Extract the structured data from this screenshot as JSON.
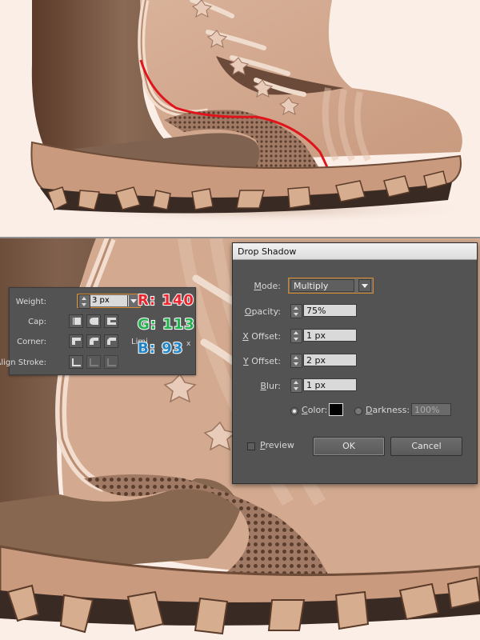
{
  "stroke_panel": {
    "weight_label": "Weight:",
    "weight_value": "3 px",
    "cap_label": "Cap:",
    "corner_label": "Corner:",
    "limit_label": "Limi",
    "limit_suffix": "x",
    "align_label": "Align Stroke:"
  },
  "rgb_callout": {
    "r": "R: 140",
    "g": "G: 113",
    "b": "B: 93",
    "colors": {
      "r": "#e8262f",
      "g": "#23b14d",
      "b": "#1f85c8"
    }
  },
  "drop_shadow": {
    "title": "Drop Shadow",
    "mode": {
      "label": "Mode:",
      "accesskey": "M",
      "value": "Multiply"
    },
    "opacity": {
      "label": "Opacity:",
      "accesskey": "O",
      "value": "75%"
    },
    "x_offset": {
      "label": "Offset:",
      "accesskey": "X",
      "value": "1 px"
    },
    "y_offset": {
      "label": "Offset:",
      "accesskey": "Y",
      "value": "2 px"
    },
    "blur": {
      "label": "Blur:",
      "accesskey": "B",
      "value": "1 px"
    },
    "color": {
      "label": "Color:",
      "accesskey": "C",
      "swatch": "#000000",
      "selected": true
    },
    "darkness": {
      "label": "Darkness:",
      "accesskey": "D",
      "value": "100%"
    },
    "preview": {
      "label": "Preview",
      "accesskey": "P",
      "checked": false
    },
    "ok_label": "OK",
    "cancel_label": "Cancel"
  },
  "colors": {
    "background": "#fbeee6",
    "boot_leather": "#d2a88e",
    "boot_dark": "#6f4e3b",
    "highlight_path": "#e0151b",
    "panel": "#535353",
    "focus": "#d7892c"
  }
}
